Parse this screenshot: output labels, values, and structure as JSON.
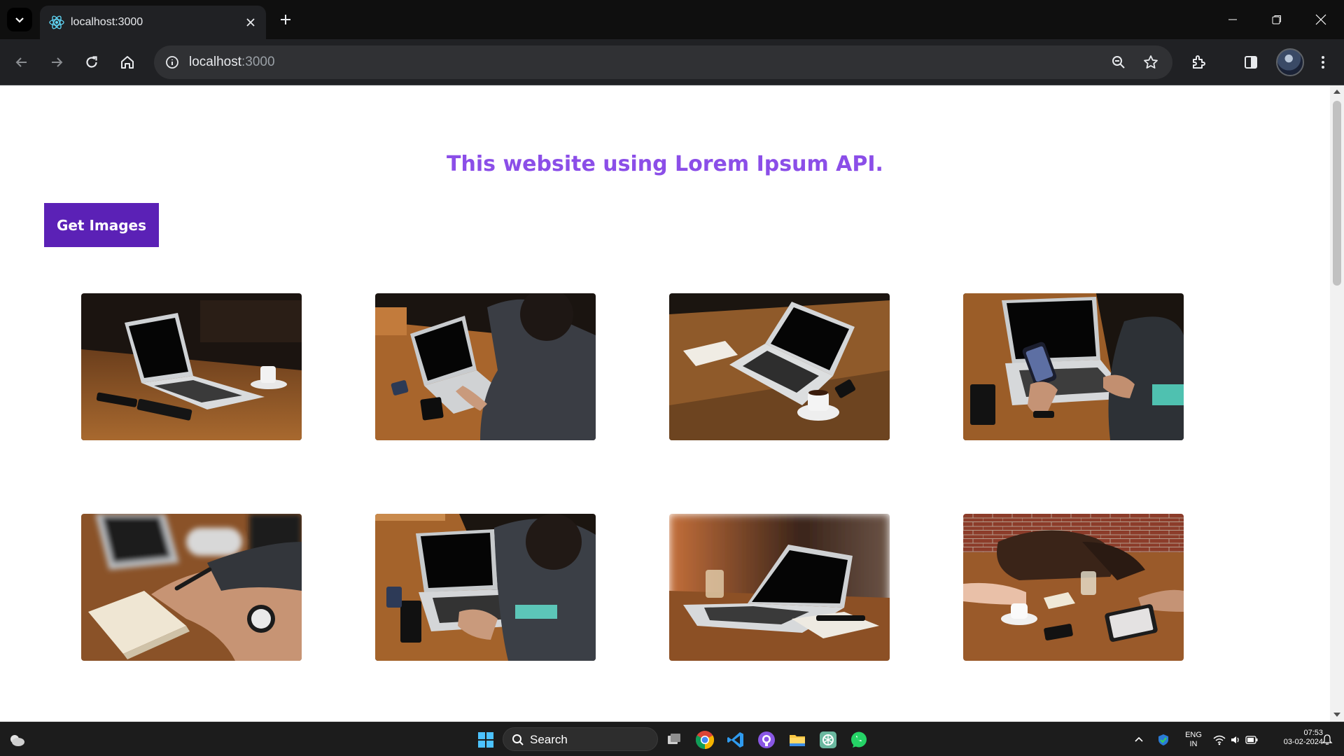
{
  "browser": {
    "tab_title": "localhost:3000",
    "url_host": "localhost",
    "url_port": ":3000"
  },
  "page": {
    "heading": "This website using Lorem Ipsum API.",
    "button_label": "Get Images"
  },
  "colors": {
    "heading": "#8b4ee8",
    "button_bg": "#5b21b6",
    "button_text": "#ffffff"
  },
  "images": [
    {
      "name": "laptop-on-wooden-table"
    },
    {
      "name": "man-typing-on-laptop"
    },
    {
      "name": "laptop-with-notebook-and-coffee"
    },
    {
      "name": "hand-holding-phone-near-laptop"
    },
    {
      "name": "hand-writing-in-notebook"
    },
    {
      "name": "man-typing-on-laptop-2"
    },
    {
      "name": "laptop-on-table-with-glass"
    },
    {
      "name": "people-at-table-with-tablet"
    }
  ],
  "taskbar": {
    "search_label": "Search",
    "lang_top": "ENG",
    "lang_bottom": "IN",
    "time": "07:53",
    "date": "03-02-2024"
  }
}
